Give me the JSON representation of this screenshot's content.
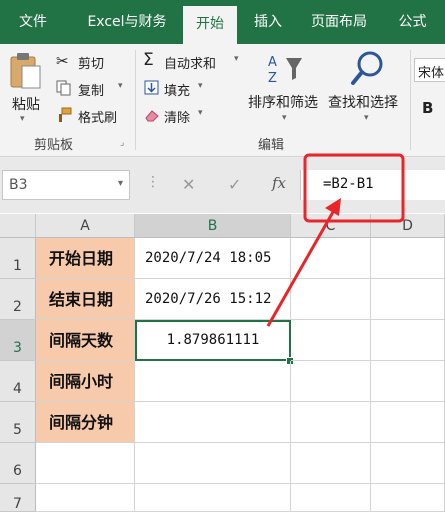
{
  "tabs": [
    "文件",
    "Excel与财务",
    "开始",
    "插入",
    "页面布局",
    "公式"
  ],
  "active_tab_index": 2,
  "ribbon": {
    "paste": "粘贴",
    "cut": "剪切",
    "copy": "复制",
    "format_painter": "格式刷",
    "clipboard_group": "剪贴板",
    "autosum": "自动求和",
    "fill": "填充",
    "clear": "清除",
    "sort_filter": "排序和筛选",
    "find_select": "查找和选择",
    "edit_group": "编辑",
    "font_name": "宋体",
    "bold": "B"
  },
  "formula_bar": {
    "name_box": "B3",
    "cancel_icon": "✕",
    "enter_icon": "✓",
    "fx": "fx",
    "formula": "=B2-B1"
  },
  "columns": [
    "A",
    "B",
    "C",
    "D"
  ],
  "rows": [
    "1",
    "2",
    "3",
    "4",
    "5",
    "6",
    "7"
  ],
  "cells": {
    "A1": "开始日期",
    "A2": "结束日期",
    "A3": "间隔天数",
    "A4": "间隔小时",
    "A5": "间隔分钟",
    "B1": "2020/7/24 18:05",
    "B2": "2020/7/26 15:12",
    "B3": "1.879861111"
  },
  "colors": {
    "accent": "#217346",
    "label_fill": "#f7caac",
    "highlight": "#e8262a"
  }
}
